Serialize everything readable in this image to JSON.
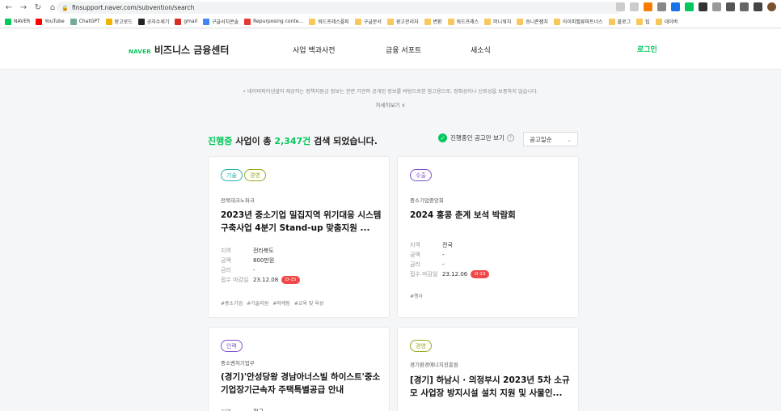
{
  "browser": {
    "url": "finsupport.naver.com/subvention/search",
    "bookmarks": [
      {
        "label": "NAVER",
        "color": "#03c75a"
      },
      {
        "label": "YouTube",
        "color": "#ff0000"
      },
      {
        "label": "ChatGPT",
        "color": "#74aa9c"
      },
      {
        "label": "랑고로드",
        "color": "#f0b400"
      },
      {
        "label": "공자수세기",
        "color": "#222222"
      },
      {
        "label": "gmail",
        "color": "#d93025"
      },
      {
        "label": "구글서치콘솔",
        "color": "#4285f4"
      },
      {
        "label": "Repurposing conte...",
        "color": "#e53935"
      },
      {
        "label": "워드프레스플피",
        "color": "#f9c85c"
      },
      {
        "label": "구글문서",
        "color": "#f9c85c"
      },
      {
        "label": "광고관리자",
        "color": "#f9c85c"
      },
      {
        "label": "변환",
        "color": "#f9c85c"
      },
      {
        "label": "워드프레스",
        "color": "#f9c85c"
      },
      {
        "label": "머니워치",
        "color": "#f9c85c"
      },
      {
        "label": "승니존잼치",
        "color": "#f9c85c"
      },
      {
        "label": "아이피벨류파트너스",
        "color": "#f9c85c"
      },
      {
        "label": "블로그",
        "color": "#f9c85c"
      },
      {
        "label": "팁",
        "color": "#f9c85c"
      },
      {
        "label": "네이버",
        "color": "#f9c85c"
      }
    ]
  },
  "header": {
    "brand": "NAVER",
    "title": "비즈니스 금융센터",
    "nav": [
      "사업 백과사전",
      "금융 서포트",
      "새소식"
    ],
    "login": "로그인"
  },
  "notice": {
    "text": "• 네이버파이낸셜이 제공하는 정책지원금 정보는 관련 기관의 공개된 정보를 바탕으로한 참고용으로, 정확성이나 신뢰성을 보증하지 않습니다.",
    "detail": "자세히보기 ∨"
  },
  "results": {
    "prefix": "진행중",
    "middle": " 사업이 총 ",
    "count": "2,347건",
    "suffix": " 검색 되었습니다.",
    "ongoing_toggle": "진행중인 공고만 보기",
    "sort": "공고일순"
  },
  "cards": [
    {
      "tags": [
        {
          "label": "기술",
          "color": "#20b2aa"
        },
        {
          "label": "경영",
          "color": "#9aa61a"
        }
      ],
      "org": "전북테크노파크",
      "title": "2023년 중소기업 밀집지역 위기대응 시스템 구축사업 4분기 Stand-up 맞춤지원 ...",
      "meta": [
        {
          "k": "지역",
          "v": "전라북도"
        },
        {
          "k": "금액",
          "v": "800만원"
        },
        {
          "k": "금리",
          "v": "-"
        },
        {
          "k": "접수 마감일",
          "v": "23.12.08",
          "dday": "D-15"
        }
      ],
      "hashtags": [
        "#중소기업",
        "#기술지원",
        "#마케팅",
        "#교육 및 육성"
      ]
    },
    {
      "tags": [
        {
          "label": "수출",
          "color": "#7b52c9"
        }
      ],
      "org": "중소기업중앙회",
      "title": "2024 홍콩 춘계 보석 박람회",
      "meta": [
        {
          "k": "지역",
          "v": "전국"
        },
        {
          "k": "금액",
          "v": "-"
        },
        {
          "k": "금리",
          "v": "-"
        },
        {
          "k": "접수 마감일",
          "v": "23.12.06",
          "dday": "D-13"
        }
      ],
      "hashtags": [
        "#행사"
      ]
    },
    {
      "tags": [
        {
          "label": "인력",
          "color": "#7b52c9"
        }
      ],
      "org": "중소벤처기업부",
      "title": "(경기)'안성당왕 경남아너스빌 하이스트'중소기업장기근속자 주택특별공급 안내",
      "meta": [
        {
          "k": "지역",
          "v": "전국"
        }
      ],
      "hashtags": []
    },
    {
      "tags": [
        {
          "label": "경영",
          "color": "#9aa61a"
        }
      ],
      "org": "경기환경에너지진흥원",
      "title": "[경기] 하남시 · 의정부시 2023년 5차 소규모 사업장 방지시설 설치 지원 및 사물인...",
      "meta": [],
      "hashtags": []
    }
  ]
}
